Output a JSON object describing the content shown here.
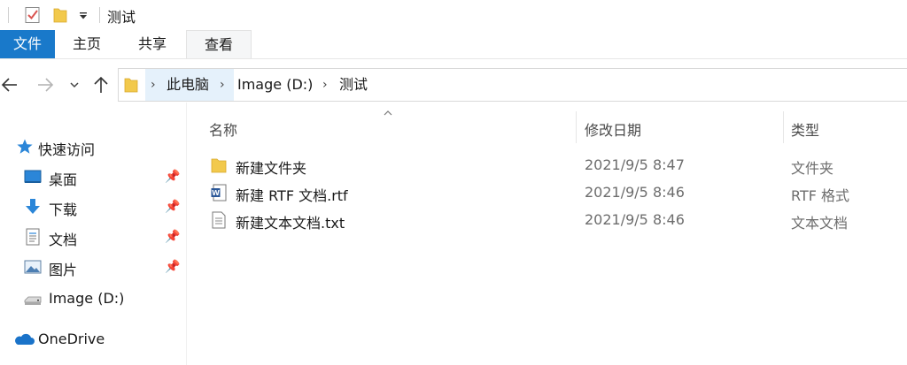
{
  "window": {
    "title": "测试"
  },
  "ribbon": {
    "tabs": [
      "文件",
      "主页",
      "共享",
      "查看"
    ]
  },
  "nav": {
    "back": "back-arrow-icon",
    "forward": "forward-arrow-icon",
    "recent": "chevron-down-icon",
    "up": "up-arrow-icon"
  },
  "address": {
    "crumbs": [
      "此电脑",
      "Image (D:)",
      "测试"
    ]
  },
  "sidebar": {
    "items": [
      {
        "label": "快速访问",
        "icon": "star-icon"
      },
      {
        "label": "桌面",
        "icon": "desktop-icon",
        "pinned": true
      },
      {
        "label": "下载",
        "icon": "download-icon",
        "pinned": true
      },
      {
        "label": "文档",
        "icon": "document-icon",
        "pinned": true
      },
      {
        "label": "图片",
        "icon": "picture-icon",
        "pinned": true
      },
      {
        "label": "Image (D:)",
        "icon": "drive-icon"
      },
      {
        "label": "OneDrive",
        "icon": "cloud-icon"
      }
    ]
  },
  "columns": {
    "name": "名称",
    "modified": "修改日期",
    "type": "类型"
  },
  "files": [
    {
      "name": "新建文件夹",
      "modified": "2021/9/5 8:47",
      "type": "文件夹",
      "icon": "folder-icon"
    },
    {
      "name": "新建 RTF 文档.rtf",
      "modified": "2021/9/5 8:46",
      "type": "RTF 格式",
      "icon": "word-document-icon"
    },
    {
      "name": "新建文本文档.txt",
      "modified": "2021/9/5 8:46",
      "type": "文本文档",
      "icon": "text-file-icon"
    }
  ],
  "colors": {
    "accent": "#1979ca",
    "folder": "#f2c94c",
    "selected_crumb": "#e5f1fb"
  }
}
